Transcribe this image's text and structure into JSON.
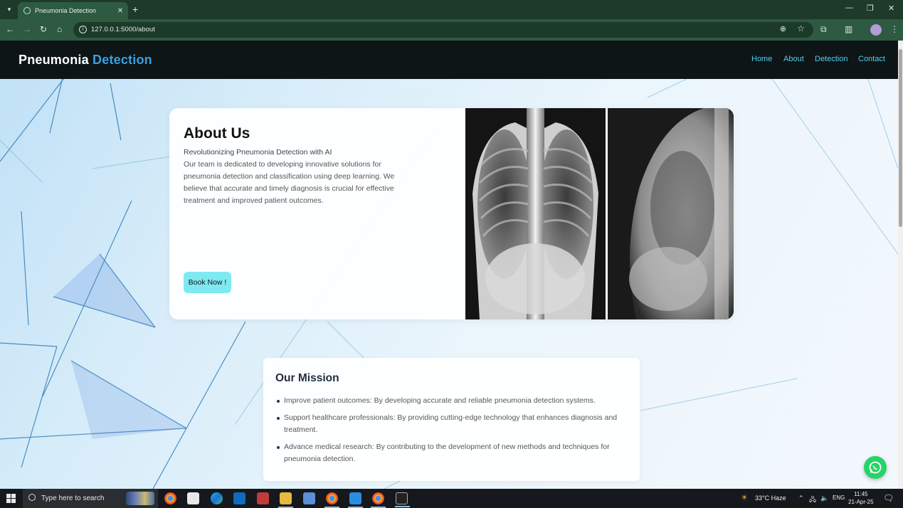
{
  "browser": {
    "tab_title": "Pneumonia Detection",
    "tab_close": "✕",
    "new_tab": "+",
    "url": "127.0.0.1:5000/about",
    "window_controls": {
      "minimize": "—",
      "maximize": "❐",
      "close": "✕"
    }
  },
  "site": {
    "brand_main": "Pneumonia",
    "brand_accent": "Detection",
    "nav": [
      "Home",
      "About",
      "Detection",
      "Contact"
    ]
  },
  "about": {
    "title": "About Us",
    "subtitle": "Revolutionizing Pneumonia Detection with AI",
    "body": "Our team is dedicated to developing innovative solutions for pneumonia detection and classification using deep learning. We believe that accurate and timely diagnosis is crucial for effective treatment and improved patient outcomes.",
    "button": "Book Now !"
  },
  "mission": {
    "title": "Our Mission",
    "items": [
      "Improve patient outcomes: By developing accurate and reliable pneumonia detection systems.",
      "Support healthcare professionals: By providing cutting-edge technology that enhances diagnosis and treatment.",
      "Advance medical research: By contributing to the development of new methods and techniques for pneumonia detection."
    ]
  },
  "taskbar": {
    "search_placeholder": "Type here to search",
    "weather": "33°C  Haze",
    "language": "ENG",
    "time": "11:45",
    "date": "21-Apr-25"
  },
  "colors": {
    "header_bg": "#0d1517",
    "brand_accent": "#3aa0e3",
    "nav_link": "#4fd0ee",
    "button_bg": "#7fe9f2",
    "whatsapp": "#25d366"
  }
}
